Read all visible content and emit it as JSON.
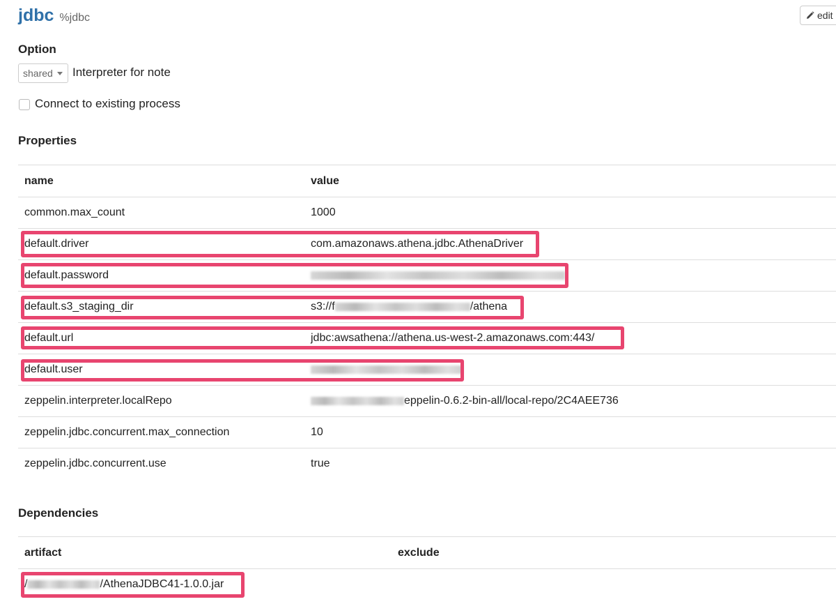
{
  "header": {
    "title": "jdbc",
    "subtitle": "%jdbc",
    "edit_label": "edit"
  },
  "option": {
    "title": "Option",
    "mode_selected": "shared",
    "mode_label": "Interpreter for note",
    "connect_label": "Connect to existing process"
  },
  "properties": {
    "title": "Properties",
    "col_name": "name",
    "col_value": "value",
    "rows": [
      {
        "name": "common.max_count",
        "value": "1000",
        "value_suffix": ""
      },
      {
        "name": "default.driver",
        "value": "com.amazonaws.athena.jdbc.AthenaDriver",
        "value_suffix": ""
      },
      {
        "name": "default.password",
        "value": "",
        "value_suffix": ""
      },
      {
        "name": "default.s3_staging_dir",
        "value": "s3://f",
        "value_suffix": "/athena"
      },
      {
        "name": "default.url",
        "value": "jdbc:awsathena://athena.us-west-2.amazonaws.com:443/",
        "value_suffix": ""
      },
      {
        "name": "default.user",
        "value": "",
        "value_suffix": ""
      },
      {
        "name": "zeppelin.interpreter.localRepo",
        "value": "",
        "value_suffix": "eppelin-0.6.2-bin-all/local-repo/2C4AEE736"
      },
      {
        "name": "zeppelin.jdbc.concurrent.max_connection",
        "value": "10",
        "value_suffix": ""
      },
      {
        "name": "zeppelin.jdbc.concurrent.use",
        "value": "true",
        "value_suffix": ""
      }
    ]
  },
  "dependencies": {
    "title": "Dependencies",
    "col_artifact": "artifact",
    "col_exclude": "exclude",
    "rows": [
      {
        "artifact_prefix": "/",
        "artifact": "/AthenaJDBC41-1.0.0.jar",
        "exclude": ""
      }
    ]
  },
  "colors": {
    "accent": "#3071a9",
    "highlight": "#e8456f"
  }
}
